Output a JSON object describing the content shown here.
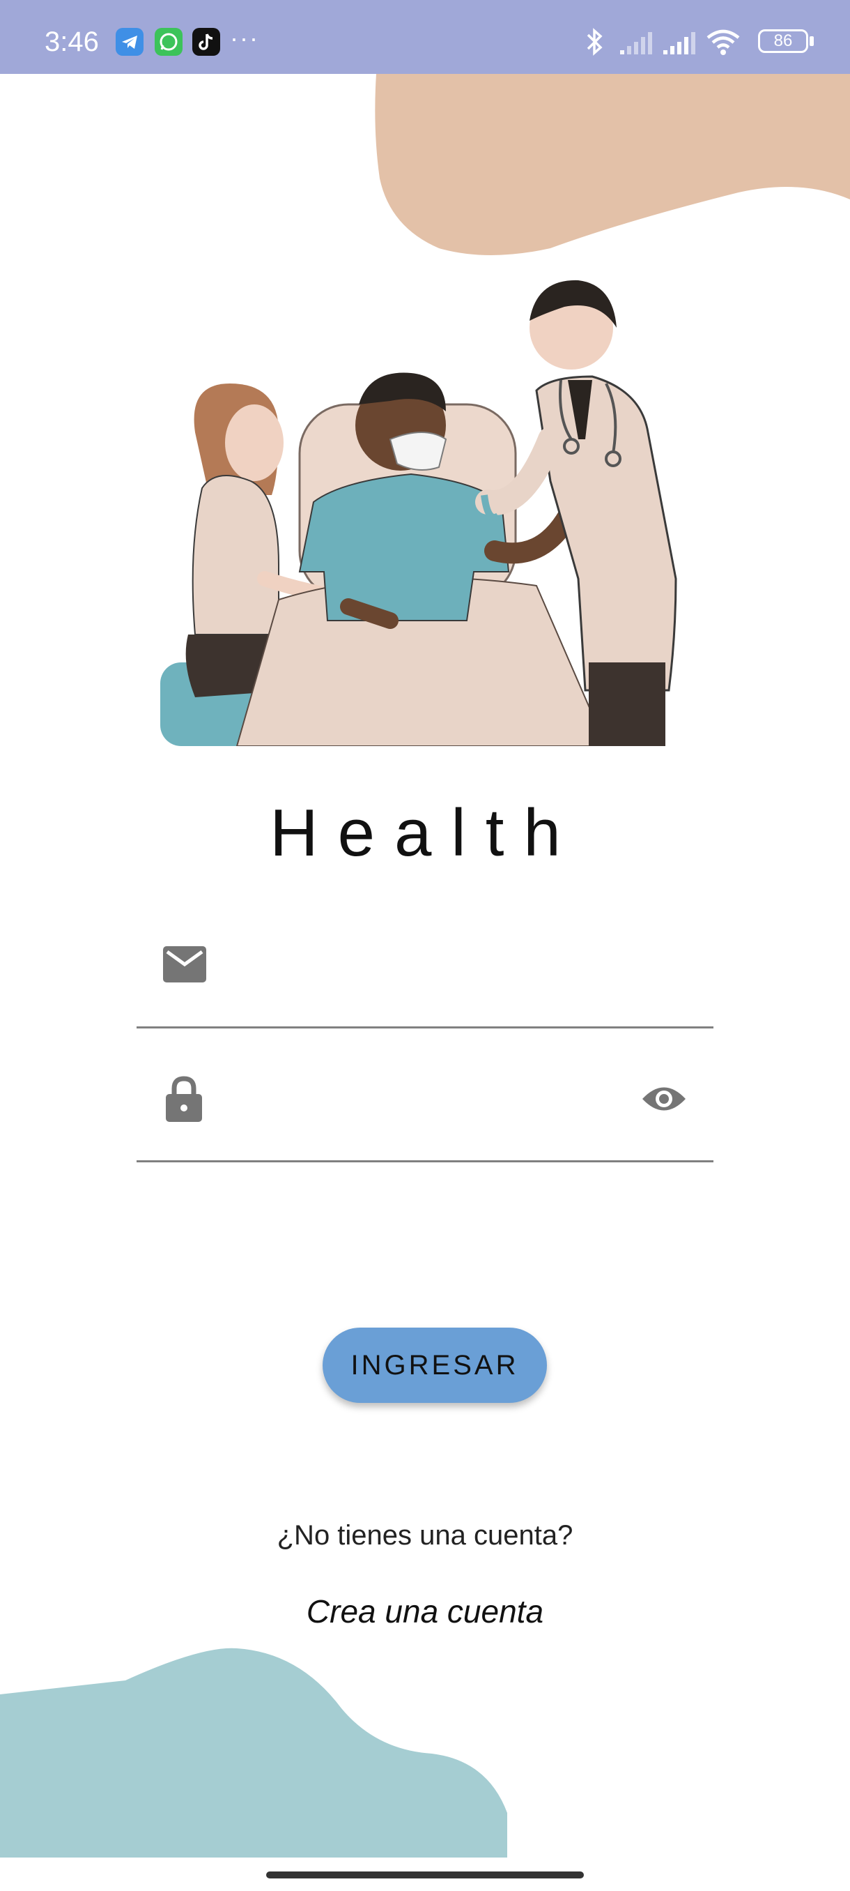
{
  "status_bar": {
    "time": "3:46",
    "more": "···",
    "battery_level": "86",
    "notification_icons": [
      "telegram-icon",
      "whatsapp-icon",
      "tiktok-icon"
    ],
    "system_icons": [
      "bluetooth-icon",
      "signal-weak-icon",
      "signal-icon",
      "wifi-icon",
      "battery-icon"
    ],
    "background_color": "#a0a8d8"
  },
  "app": {
    "title": "Health"
  },
  "form": {
    "email": {
      "icon": "mail-icon",
      "value": "",
      "placeholder": ""
    },
    "password": {
      "icon": "lock-icon",
      "toggle_icon": "eye-icon",
      "value": "",
      "placeholder": ""
    },
    "submit_label": "INGRESAR"
  },
  "footer": {
    "prompt": "¿No tienes una cuenta?",
    "create_link": "Crea una cuenta"
  },
  "colors": {
    "button": "#6a9fd6",
    "blob_top": "#e3c1a8",
    "blob_bottom": "#a5cdd2"
  }
}
